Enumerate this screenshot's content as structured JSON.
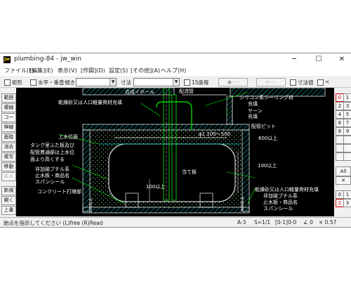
{
  "window": {
    "title": "plumbing-84 - jw_win",
    "app_icon": "Jw",
    "controls": [
      "─",
      "☐",
      "✕"
    ]
  },
  "menu": [
    "ファイル(F)",
    "[編集](E)",
    "表示(V)",
    "[作図](D)",
    "設定(S)",
    "[その他](A)",
    "ヘルプ(H)"
  ],
  "toolbar": {
    "rect_label": "矩形",
    "hv_label": "水平・垂直",
    "slope_label": "傾き",
    "dim_label": "寸法",
    "deg15_label": "15度毎",
    "disabled1": "●----",
    "disabled2": "<----",
    "dimvalue_label": "寸法値",
    "lt_label": "<"
  },
  "left_tools": [
    "範囲",
    "複線",
    "コーナー",
    "伸縮",
    "面取",
    "消去",
    "複写",
    "移動",
    "戻る",
    "新規",
    "開く",
    "上書"
  ],
  "right_tools": {
    "grid": [
      "0",
      "1",
      "2",
      "3",
      "4",
      "5",
      "6",
      "7",
      "8",
      "9"
    ],
    "all_label": "All",
    "bottom": [
      "0",
      "1",
      "2",
      "3"
    ]
  },
  "drawing": {
    "top_labels": [
      "合成イボール",
      "配流管"
    ],
    "notes": [
      "シリコン系シーリング材",
      "充填",
      "ヤーン",
      "充填",
      "配管ピット",
      "乾燥砂又は人口軽量骨材充填",
      "φ1 100〜500",
      "600以上",
      "上水位面",
      "タンク室ふた板及び",
      "配管貫通部は上水位",
      "面より高くする",
      "非加硫ブチル系",
      "止水板・商品名",
      "スパンシール",
      "コンクリート打継部",
      "100以上",
      "100以上",
      "当て板",
      "乾燥砂又は人口軽量骨材充填",
      "非加硫ブチル系",
      "止水板・商品名",
      "スパンシール",
      "300以上",
      "300以上"
    ]
  },
  "status": {
    "prompt": "始点を指示してください (L)free (R)Read",
    "paper": "A-3",
    "scale": "S=1/1",
    "layer": "[0-1]0-0",
    "angle": "∠ 0",
    "zoom": "× 0.57"
  },
  "colors": {
    "canvas_bg": "#000000",
    "wall": "#ffffff",
    "hatch": "#00c8c8",
    "pipe": "#00c800",
    "leader": "#00ff00",
    "red_button": "#d00000"
  }
}
